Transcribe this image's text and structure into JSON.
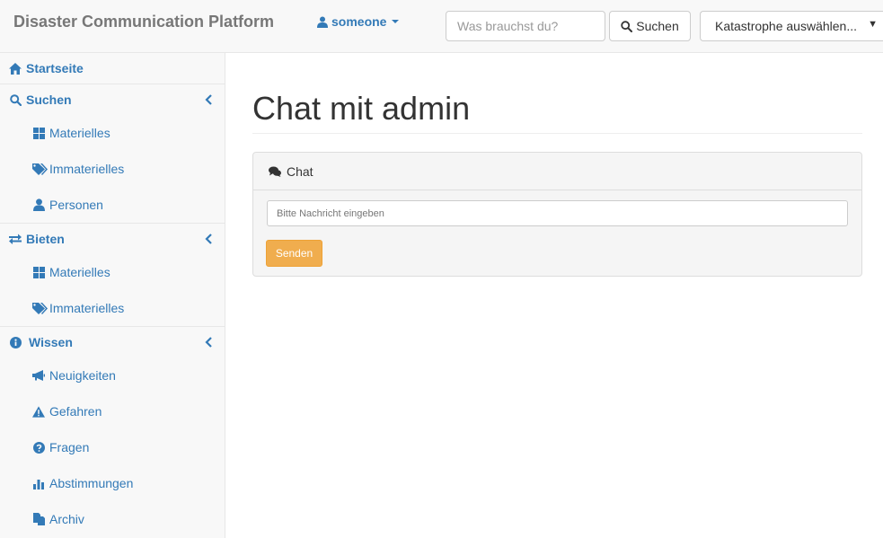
{
  "navbar": {
    "brand": "Disaster Communication Platform",
    "user": "someone",
    "search_placeholder": "Was brauchst du?",
    "search_label": "Suchen",
    "disaster_select": "Katastrophe auswählen..."
  },
  "sidebar": {
    "home": "Startseite",
    "search": {
      "label": "Suchen",
      "items": [
        "Materielles",
        "Immaterielles",
        "Personen"
      ]
    },
    "offer": {
      "label": "Bieten",
      "items": [
        "Materielles",
        "Immaterielles"
      ]
    },
    "knowledge": {
      "label": "Wissen",
      "items": [
        "Neuigkeiten",
        "Gefahren",
        "Fragen",
        "Abstimmungen",
        "Archiv"
      ]
    }
  },
  "main": {
    "title": "Chat mit admin",
    "panel_heading": "Chat",
    "message_placeholder": "Bitte Nachricht eingeben",
    "send_label": "Senden"
  },
  "colors": {
    "link": "#337ab7",
    "warning_button": "#f0ad4e",
    "navbar_bg": "#f8f8f8"
  },
  "icons": {
    "user": "user-icon",
    "search": "search-icon",
    "home": "home-icon",
    "offer": "exchange-icon",
    "knowledge": "info-circle-icon",
    "chat": "comments-icon"
  }
}
